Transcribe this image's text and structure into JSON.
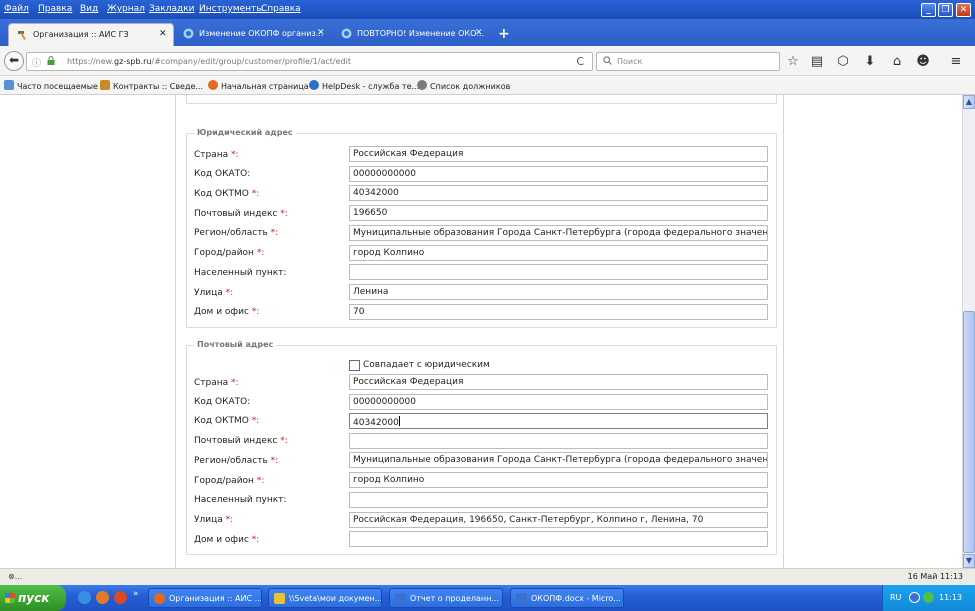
{
  "menubar": {
    "items": [
      "Файл",
      "Правка",
      "Вид",
      "Журнал",
      "Закладки",
      "Инструменты",
      "Справка"
    ]
  },
  "tabs": [
    {
      "label": "Организация :: АИС ГЗ",
      "close": "✕"
    },
    {
      "label": "Изменение ОКОПФ организ...",
      "close": "✕"
    },
    {
      "label": "ПОВТОРНО! Изменение ОКО...",
      "close": "✕"
    }
  ],
  "newtab": "+",
  "nav": {
    "back": "⬅",
    "info_icon": "ⓘ",
    "lock_icon": "🔒",
    "url_prefix": "https://new.",
    "url_host": "gz-spb.ru",
    "url_path": "/#company/edit/group/customer/profile/1/act/edit",
    "reload": "C",
    "search_placeholder": "Поиск",
    "search_icon": "🔍"
  },
  "toolbar_icons": [
    "☆",
    "▤",
    "⬡",
    "⬇",
    "⌂",
    "☻",
    "≡"
  ],
  "bookmarks": [
    {
      "label": "Часто посещаемые",
      "color": "#5a8fd6"
    },
    {
      "label": "Контракты :: Сведе...",
      "color": "#c98a2c"
    },
    {
      "label": "Начальная страница",
      "color": "#e06a1e"
    },
    {
      "label": "HelpDesk - служба те...",
      "color": "#2f6fc8"
    },
    {
      "label": "Список должников",
      "color": "#7a7a7a"
    }
  ],
  "legal_address": {
    "legend": "Юридический адрес",
    "fields": [
      {
        "label": "Страна",
        "required": true,
        "value": "Российская Федерация"
      },
      {
        "label": "Код ОКАТО:",
        "required": false,
        "value": "00000000000"
      },
      {
        "label": "Код ОКТМО",
        "required": true,
        "value": "40342000"
      },
      {
        "label": "Почтовый индекс",
        "required": true,
        "value": "196650"
      },
      {
        "label": "Регион/область",
        "required": true,
        "value": "Муниципальные образования Города Санкт-Петербурга (города федерального значения)"
      },
      {
        "label": "Город/район",
        "required": true,
        "value": "город Колпино"
      },
      {
        "label": "Населенный пункт:",
        "required": false,
        "value": ""
      },
      {
        "label": "Улица",
        "required": true,
        "value": "Ленина"
      },
      {
        "label": "Дом и офис",
        "required": true,
        "value": "70"
      }
    ]
  },
  "postal_address": {
    "legend": "Почтовый адрес",
    "checkbox_label": "Совпадает с юридическим",
    "fields": [
      {
        "label": "Страна",
        "required": true,
        "value": "Российская Федерация"
      },
      {
        "label": "Код ОКАТО:",
        "required": false,
        "value": "00000000000"
      },
      {
        "label": "Код ОКТМО",
        "required": true,
        "value": "40342000"
      },
      {
        "label": "Почтовый индекс",
        "required": true,
        "value": ""
      },
      {
        "label": "Регион/область",
        "required": true,
        "value": "Муниципальные образования Города Санкт-Петербурга (города федерального значения)"
      },
      {
        "label": "Город/район",
        "required": true,
        "value": "город Колпино"
      },
      {
        "label": "Населенный пункт:",
        "required": false,
        "value": ""
      },
      {
        "label": "Улица",
        "required": true,
        "value": "Российская Федерация, 196650, Санкт-Петербург, Колпино г, Ленина, 70"
      },
      {
        "label": "Дом и офис",
        "required": true,
        "value": ""
      }
    ]
  },
  "required_mark": "*:",
  "statusbar": {
    "text": "⊗...",
    "date": "16 Май 11:13"
  },
  "taskbar": {
    "start": "пуск",
    "more": "»",
    "tasks": [
      {
        "label": "Организация :: АИС ...",
        "color": "#e06a1e"
      },
      {
        "label": "\\\\Sveta\\мои докумен...",
        "color": "#e8c23a"
      },
      {
        "label": "Отчет о проделанн...",
        "color": "#3b6fd0"
      },
      {
        "label": "ОКОПФ.docx - Micro...",
        "color": "#3b6fd0"
      }
    ],
    "lang": "RU",
    "clock": "11:13"
  }
}
